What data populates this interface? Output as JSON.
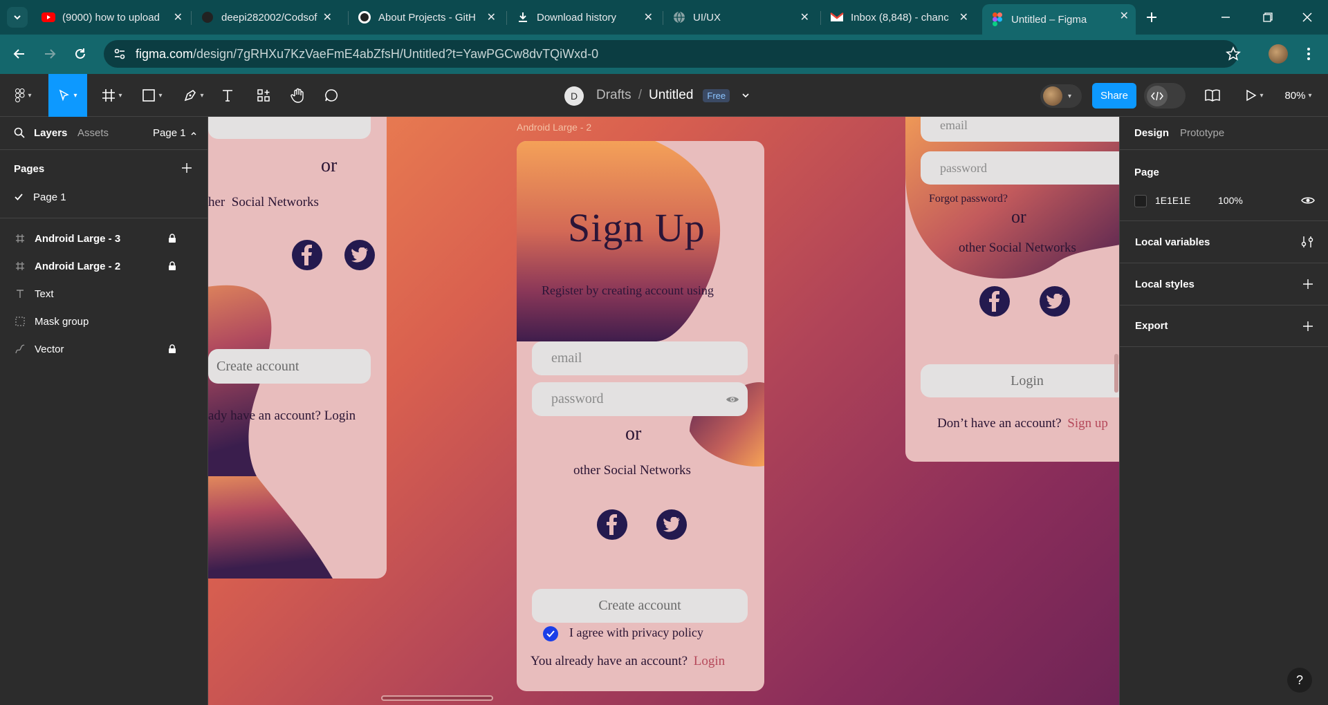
{
  "browser": {
    "tabs": [
      {
        "title": "(9000) how to upload",
        "icon": "youtube-icon"
      },
      {
        "title": "deepi282002/Codsof",
        "icon": "github-icon"
      },
      {
        "title": "About Projects - GitH",
        "icon": "github-icon"
      },
      {
        "title": "Download history",
        "icon": "download-icon"
      },
      {
        "title": "UI/UX",
        "icon": "globe-icon"
      },
      {
        "title": "Inbox (8,848) - chanc",
        "icon": "gmail-icon"
      },
      {
        "title": "Untitled – Figma",
        "icon": "figma-icon"
      }
    ],
    "url_domain": "figma.com",
    "url_path": "/design/7gRHXu7KzVaeFmE4abZfsH/Untitled?t=YawPGCw8dvTQiWxd-0"
  },
  "toolbar": {
    "avatar_letter": "D",
    "breadcrumb_drafts": "Drafts",
    "breadcrumb_sep": "/",
    "file_name": "Untitled",
    "plan_badge": "Free",
    "share_label": "Share",
    "zoom": "80%"
  },
  "left_panel": {
    "tab_layers": "Layers",
    "tab_assets": "Assets",
    "page_selector": "Page 1",
    "pages_heading": "Pages",
    "pages": [
      "Page 1"
    ],
    "layers": [
      {
        "name": "Android Large - 3",
        "type": "frame",
        "locked": true
      },
      {
        "name": "Android Large - 2",
        "type": "frame",
        "locked": true
      },
      {
        "name": "Text",
        "type": "text",
        "locked": false
      },
      {
        "name": "Mask group",
        "type": "mask",
        "locked": false
      },
      {
        "name": "Vector",
        "type": "vector",
        "locked": true
      }
    ]
  },
  "right_panel": {
    "tab_design": "Design",
    "tab_prototype": "Prototype",
    "page_heading": "Page",
    "page_color": "1E1E1E",
    "page_opacity": "100%",
    "local_variables": "Local variables",
    "local_styles": "Local styles",
    "export": "Export"
  },
  "canvas": {
    "frame_label": "Android Large - 2",
    "left_frame": {
      "or": "or",
      "social": "her  Social Networks",
      "button": "Create account",
      "footer": "ady have an account?",
      "footer_link": "Login"
    },
    "center_frame": {
      "title": "Sign Up",
      "subtitle": "Register by creating account using",
      "email_placeholder": "email",
      "password_placeholder": "password",
      "or": "or",
      "social": "other Social Networks",
      "button": "Create account",
      "agree": "I agree with privacy policy",
      "footer": "You already have an account?",
      "footer_link": "Login"
    },
    "right_frame": {
      "email_placeholder": "email",
      "password_placeholder": "password",
      "forgot": "Forgot password?",
      "or": "or",
      "social": "other Social Networks",
      "button": "Login",
      "footer": "Don’t have an account?",
      "footer_link": "Sign up"
    }
  },
  "colors": {
    "accent": "#0d99ff",
    "link": "#b5485a",
    "checkbox": "#1a3ee8"
  }
}
